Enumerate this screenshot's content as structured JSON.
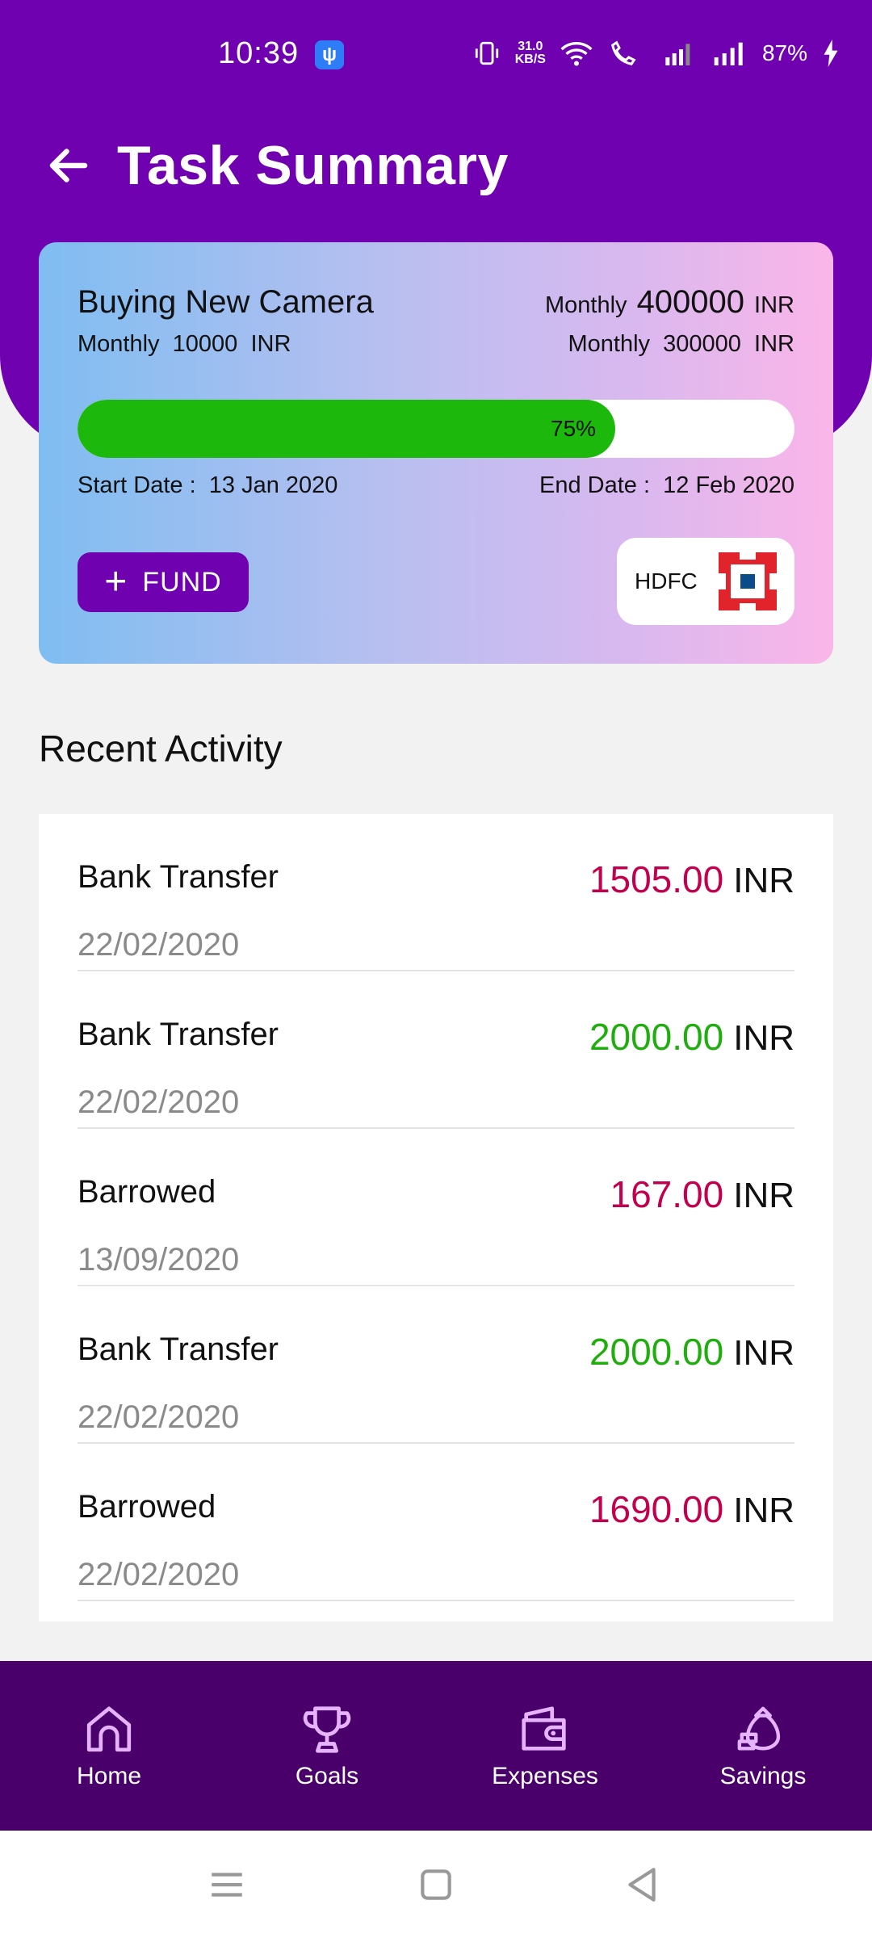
{
  "status": {
    "time": "10:39",
    "net_speed_value": "31.0",
    "net_speed_unit": "KB/S",
    "battery": "87%"
  },
  "header": {
    "title": "Task Summary"
  },
  "task": {
    "name": "Buying New Camera",
    "monthly_left_label": "Monthly",
    "monthly_left_value": "10000",
    "monthly_left_unit": "INR",
    "target_label": "Monthly",
    "target_value": "400000",
    "target_unit": "INR",
    "monthly_right_label": "Monthly",
    "monthly_right_value": "300000",
    "monthly_right_unit": "INR",
    "progress_percent": 75,
    "progress_label": "75%",
    "start_date_label": "Start Date :",
    "start_date": "13 Jan 2020",
    "end_date_label": "End Date :",
    "end_date": "12 Feb 2020",
    "fund_button_label": "FUND",
    "bank_name": "HDFC"
  },
  "recent_activity": {
    "title": "Recent Activity",
    "items": [
      {
        "title": "Bank Transfer",
        "date": "22/02/2020",
        "amount": "1505.00",
        "currency": "INR",
        "color": "#c2004d"
      },
      {
        "title": "Bank Transfer",
        "date": "22/02/2020",
        "amount": "2000.00",
        "currency": "INR",
        "color": "#1fae0e"
      },
      {
        "title": "Barrowed",
        "date": "13/09/2020",
        "amount": "167.00",
        "currency": "INR",
        "color": "#c2004d"
      },
      {
        "title": "Bank Transfer",
        "date": "22/02/2020",
        "amount": "2000.00",
        "currency": "INR",
        "color": "#1fae0e"
      },
      {
        "title": "Barrowed",
        "date": "22/02/2020",
        "amount": "1690.00",
        "currency": "INR",
        "color": "#c2004d"
      }
    ]
  },
  "bottom_nav": {
    "items": [
      {
        "label": "Home",
        "icon": "home-icon"
      },
      {
        "label": "Goals",
        "icon": "trophy-icon"
      },
      {
        "label": "Expenses",
        "icon": "wallet-icon"
      },
      {
        "label": "Savings",
        "icon": "money-bag-icon"
      }
    ]
  },
  "colors": {
    "primary": "#6f01b1",
    "nav": "#4a006b",
    "progress": "#1cb80c",
    "debit": "#c2004d",
    "credit": "#1fae0e"
  }
}
